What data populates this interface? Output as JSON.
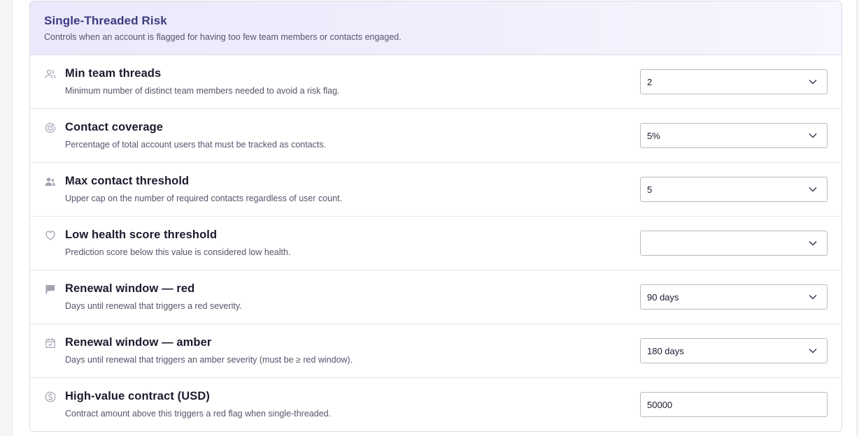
{
  "section": {
    "title": "Single-Threaded Risk",
    "subtitle": "Controls when an account is flagged for having too few team members or contacts engaged."
  },
  "settings": [
    {
      "icon": "users-icon",
      "title": "Min team threads",
      "description": "Minimum number of distinct team members needed to avoid a risk flag.",
      "control": "select",
      "value": "2"
    },
    {
      "icon": "target-icon",
      "title": "Contact coverage",
      "description": "Percentage of total account users that must be tracked as contacts.",
      "control": "select",
      "value": "5%"
    },
    {
      "icon": "contacts-icon",
      "title": "Max contact threshold",
      "description": "Upper cap on the number of required contacts regardless of user count.",
      "control": "select",
      "value": "5"
    },
    {
      "icon": "heart-icon",
      "title": "Low health score threshold",
      "description": "Prediction score below this value is considered low health.",
      "control": "select",
      "value": ""
    },
    {
      "icon": "flag-icon",
      "title": "Renewal window — red",
      "description": "Days until renewal that triggers a red severity.",
      "control": "select",
      "value": "90 days"
    },
    {
      "icon": "calendar-check-icon",
      "title": "Renewal window — amber",
      "description": "Days until renewal that triggers an amber severity (must be ≥ red window).",
      "control": "select",
      "value": "180 days"
    },
    {
      "icon": "dollar-circle-icon",
      "title": "High-value contract (USD)",
      "description": "Contract amount above this triggers a red flag when single-threaded.",
      "control": "input",
      "value": "50000"
    }
  ],
  "colors": {
    "accent_title": "#3d3a80",
    "icon_muted": "#a3a2b3",
    "header_bg": "#ebe8fb"
  }
}
